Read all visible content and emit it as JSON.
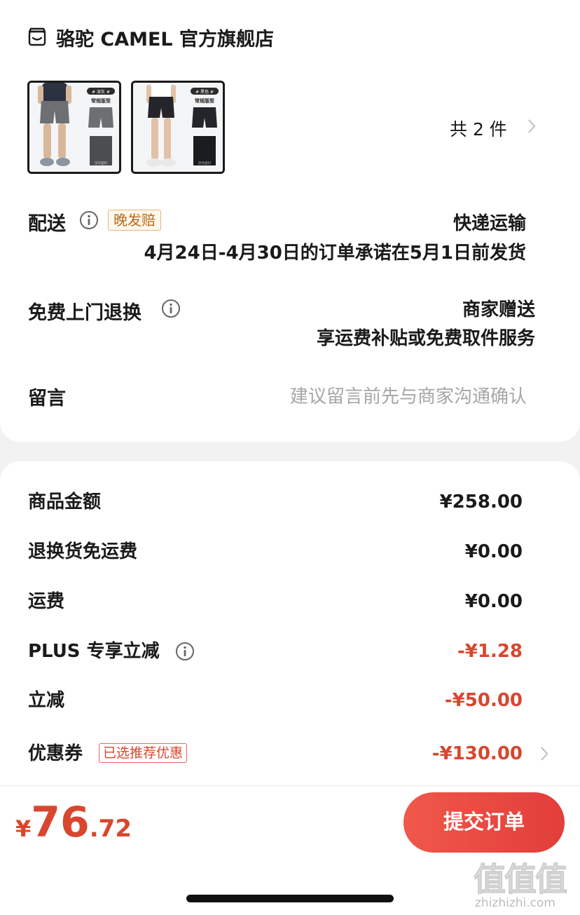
{
  "store": {
    "name": "骆驼 CAMEL 官方旗舰店",
    "icon": "store-icon"
  },
  "products": {
    "count_label": "共 2 件",
    "thumbnails": [
      {
        "tag": "# 深灰 #",
        "fit": "常规版型",
        "color": "#6d6f72",
        "swatch_label": "深灰面料"
      },
      {
        "tag": "# 黑色 #",
        "fit": "常规版型",
        "color": "#23252b",
        "swatch_label": "黑色面料"
      }
    ]
  },
  "delivery": {
    "label": "配送",
    "badge": "晚发赔",
    "method": "快递运输",
    "promise": "4月24日-4月30日的订单承诺在5月1日前发货"
  },
  "free_return": {
    "label": "免费上门退换",
    "line1": "商家赠送",
    "line2": "享运费补贴或免费取件服务"
  },
  "message": {
    "label": "留言",
    "placeholder": "建议留言前先与商家沟通确认"
  },
  "fees": [
    {
      "label": "商品金额",
      "value": "¥258.00",
      "color": "black"
    },
    {
      "label": "退换货免运费",
      "value": "¥0.00",
      "color": "black"
    },
    {
      "label": "运费",
      "value": "¥0.00",
      "color": "black"
    },
    {
      "label": "PLUS 专享立减",
      "value": "-¥1.28",
      "color": "red",
      "info": true
    },
    {
      "label": "立减",
      "value": "-¥50.00",
      "color": "red"
    },
    {
      "label": "优惠券",
      "value": "-¥130.00",
      "color": "red",
      "badge": "已选推荐优惠",
      "chevron": true
    }
  ],
  "footer": {
    "currency": "¥",
    "total_int": "76",
    "total_dec": ".72",
    "submit_label": "提交订单"
  },
  "watermark": {
    "glyphs": "值值值",
    "url": "zhizhizhi.com"
  },
  "colors": {
    "accent_red": "#d9462e",
    "button_start": "#f0584a",
    "button_end": "#e23d3a",
    "badge_orange": "#b56a1e"
  }
}
